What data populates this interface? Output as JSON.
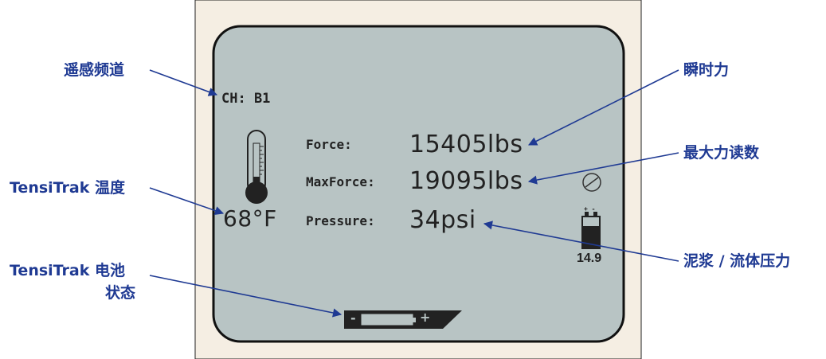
{
  "display": {
    "channel": "CH: B1",
    "temperature": "68°F",
    "force_label": "Force:",
    "force_value": "15405lbs",
    "maxforce_label": "MaxForce:",
    "maxforce_value": "19095lbs",
    "pressure_label": "Pressure:",
    "pressure_value": "34psi",
    "battery_voltage": "14.9",
    "battery_terminals": "+ -",
    "bar_minus": "-",
    "bar_plus": "+"
  },
  "callouts": {
    "channel": "遥感频道",
    "temperature": "TensiTrak 温度",
    "battery_line1": "TensiTrak 电池",
    "battery_line2": "状态",
    "force": "瞬时力",
    "maxforce": "最大力读数",
    "pressure": "泥浆 / 流体压力"
  },
  "colors": {
    "frame_bg": "#f5eee3",
    "lcd_bg": "#b8c4c4",
    "callout_text": "#1f3a93",
    "leader_line": "#1f3a93",
    "lcd_ink": "#222222"
  }
}
